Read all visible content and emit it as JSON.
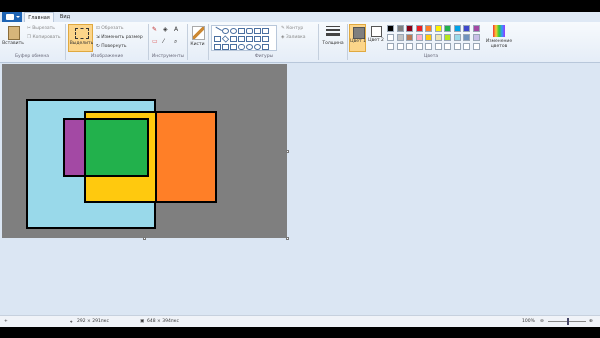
{
  "tabs": {
    "home": "Главная",
    "view": "Вид"
  },
  "clipboard": {
    "paste": "Вставить",
    "cut": "Вырезать",
    "copy": "Копировать",
    "label": "Буфер обмена"
  },
  "image": {
    "select": "Выделить",
    "crop": "Обрезать",
    "resize": "Изменить размер",
    "rotate": "Повернуть",
    "label": "Изображение"
  },
  "tools": {
    "label": "Инструменты"
  },
  "brushes": {
    "label": "Кисти"
  },
  "shapes": {
    "outline": "Контур",
    "fill": "Заливка",
    "label": "Фигуры"
  },
  "size": {
    "label": "Толщина"
  },
  "colors": {
    "color1": "Цвет 1",
    "color2": "Цвет 2",
    "edit": "Изменение цветов",
    "label": "Цвета",
    "palette": [
      "#000000",
      "#7f7f7f",
      "#880015",
      "#ed1c24",
      "#ff7f27",
      "#fff200",
      "#22b14c",
      "#00a2e8",
      "#3f48cc",
      "#a349a4",
      "#ffffff",
      "#c3c3c3",
      "#b97a57",
      "#ffaec9",
      "#ffc90e",
      "#efe4b0",
      "#b5e61d",
      "#99d9ea",
      "#7092be",
      "#c8bfe7"
    ],
    "color1_value": "#7f7f7f",
    "color2_value": "#ffffff"
  },
  "canvas_colors": {
    "background": "#7f7f7f",
    "blue": "#99d9ea",
    "orange": "#ff7f27",
    "yellow": "#ffc90e",
    "purple": "#a349a4",
    "green": "#22b14c"
  },
  "status": {
    "cursor_pos": "292 × 291пкс",
    "canvas_size": "648 × 394пкс",
    "zoom": "100%"
  }
}
